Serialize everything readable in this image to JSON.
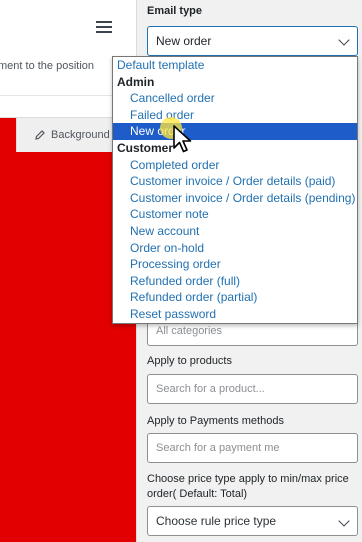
{
  "editor": {
    "position_text": "ment to the position",
    "background_tab": "Background"
  },
  "panel": {
    "email_type_label": "Email type",
    "email_type_value": "New order",
    "categories_placeholder": "All categories",
    "products_label": "Apply to products",
    "products_placeholder": "Search for a product...",
    "payments_label": "Apply to Payments methods",
    "payments_placeholder": "Search for a payment me",
    "price_type_label_line1": "Choose price type apply to min/max price",
    "price_type_label_line2": "order( Default: Total)",
    "price_type_value": "Choose rule price type"
  },
  "dropdown": {
    "default_option": "Default template",
    "admin_group": "Admin",
    "admin_options": [
      "Cancelled order",
      "Failed order",
      "New order"
    ],
    "customer_group": "Customer",
    "customer_options": [
      "Completed order",
      "Customer invoice / Order details (paid)",
      "Customer invoice / Order details (pending)",
      "Customer note",
      "New account",
      "Order on-hold",
      "Processing order",
      "Refunded order (full)",
      "Refunded order (partial)",
      "Reset password"
    ],
    "selected": "New order"
  },
  "colors": {
    "canvas": "#e20000",
    "selection": "#1e5cc9",
    "option_text": "#2271b1"
  }
}
